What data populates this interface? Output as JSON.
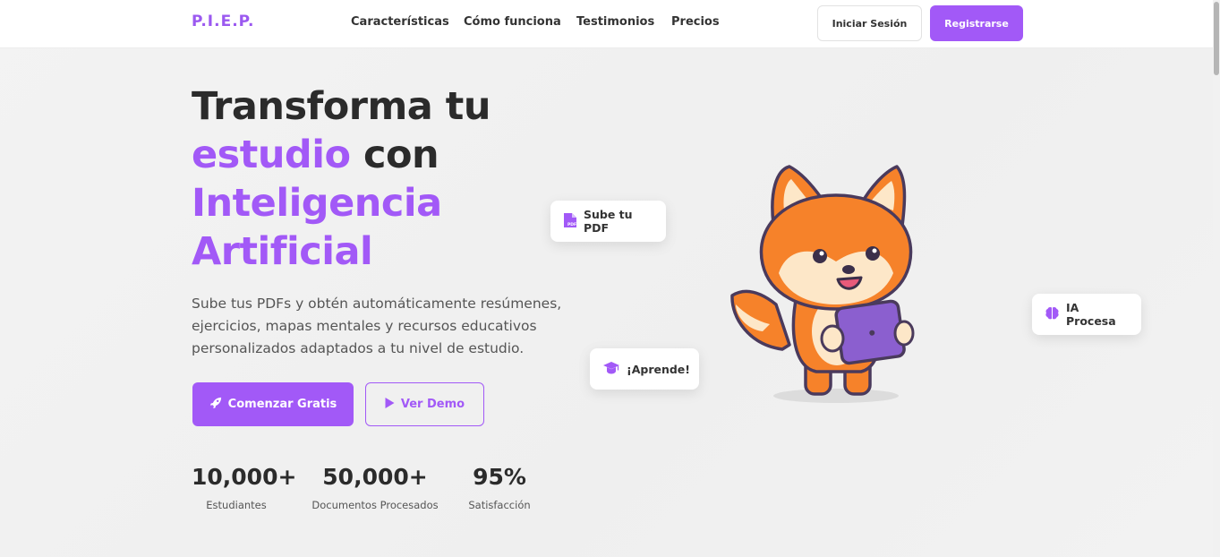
{
  "brand": {
    "logo": "P.I.E.P.",
    "accent_color": "#a259f7"
  },
  "nav": {
    "links": [
      "Características",
      "Cómo funciona",
      "Testimonios",
      "Precios"
    ],
    "login_label": "Iniciar Sesión",
    "register_label": "Registrarse"
  },
  "hero": {
    "headline": {
      "line1": "Transforma tu",
      "accent1": "estudio",
      "plain2": " con",
      "accent2": "Inteligencia",
      "accent3": "Artificial"
    },
    "subtitle": "Sube tus PDFs y obtén automáticamente resúmenes, ejercicios, mapas mentales y recursos educativos personalizados adaptados a tu nivel de estudio.",
    "primary_button": {
      "label": "Comenzar Gratis",
      "icon": "rocket-icon"
    },
    "secondary_button": {
      "label": "Ver Demo",
      "icon": "play-icon"
    },
    "stats": [
      {
        "value": "10,000+",
        "label": "Estudiantes"
      },
      {
        "value": "50,000+",
        "label": "Documentos Procesados"
      },
      {
        "value": "95%",
        "label": "Satisfacción"
      }
    ]
  },
  "illustration": {
    "mascot": "fox-with-tablet",
    "cards": [
      {
        "label": "Sube tu PDF",
        "icon": "pdf-file-icon"
      },
      {
        "label": "IA Procesa",
        "icon": "brain-icon"
      },
      {
        "label": "¡Aprende!",
        "icon": "graduation-cap-icon"
      }
    ]
  }
}
